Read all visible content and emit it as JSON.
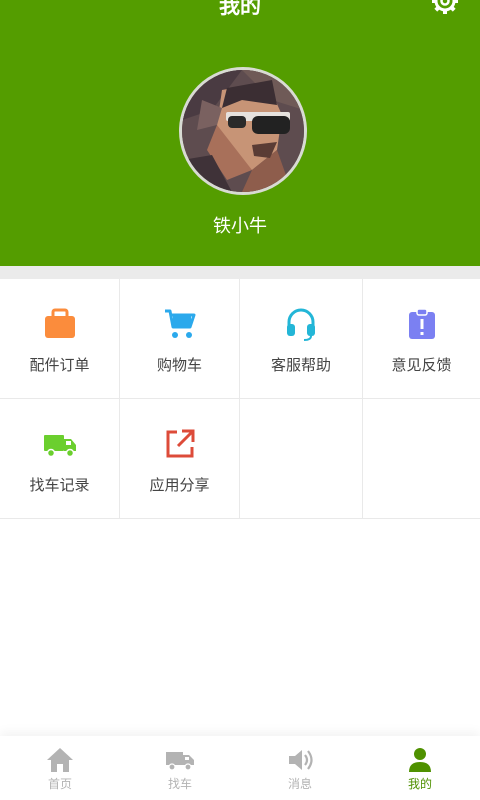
{
  "header": {
    "title": "我的",
    "username": "铁小牛",
    "bg_color": "#549d00"
  },
  "grid": [
    {
      "label": "配件订单",
      "icon": "briefcase-icon",
      "color": "#fb8c3c"
    },
    {
      "label": "购物车",
      "icon": "cart-icon",
      "color": "#2ba9ec"
    },
    {
      "label": "客服帮助",
      "icon": "headset-icon",
      "color": "#23b6d7"
    },
    {
      "label": "意见反馈",
      "icon": "clipboard-alert-icon",
      "color": "#7b80f2"
    },
    {
      "label": "找车记录",
      "icon": "truck-icon",
      "color": "#6bcf2e"
    },
    {
      "label": "应用分享",
      "icon": "share-external-icon",
      "color": "#dd4b39"
    }
  ],
  "tabbar": [
    {
      "label": "首页",
      "icon": "home-icon",
      "active": false
    },
    {
      "label": "找车",
      "icon": "truck-icon",
      "active": false
    },
    {
      "label": "消息",
      "icon": "speaker-icon",
      "active": false
    },
    {
      "label": "我的",
      "icon": "person-icon",
      "active": true
    }
  ],
  "colors": {
    "accent": "#549d00",
    "tab_active": "#4f9100",
    "tab_inactive": "#b3b3b3"
  }
}
